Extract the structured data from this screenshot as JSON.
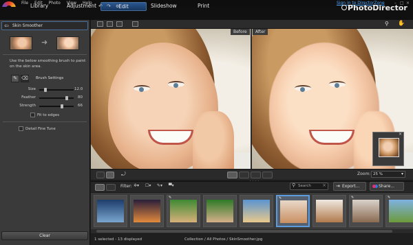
{
  "menu": {
    "items": [
      "File",
      "Edit",
      "Photo",
      "View",
      "Help"
    ]
  },
  "account": {
    "signin": "Sign in to DirectorZone"
  },
  "nav": {
    "tabs": [
      "Library",
      "Adjustment",
      "Edit",
      "Slideshow",
      "Print"
    ],
    "active": "Edit"
  },
  "brand": "PhotoDirector",
  "panel": {
    "title": "Skin Smoother",
    "description": "Use the below smoothing brush to paint on the skin area.",
    "brush_settings": "Brush Settings",
    "sliders": [
      {
        "label": "Size",
        "value": "12.0",
        "fraction": 0.12
      },
      {
        "label": "Feather",
        "value": "80",
        "fraction": 0.8
      },
      {
        "label": "Strength",
        "value": "66",
        "fraction": 0.66
      }
    ],
    "fit_to_edges": "Fit to edges",
    "detail_fine_tune": "Detail Fine Tune",
    "clear": "Clear"
  },
  "viewer": {
    "before": "Before",
    "after": "After"
  },
  "zoom": {
    "label": "Zoom:",
    "value": "25 %"
  },
  "filter": {
    "label": "Filter:",
    "search_placeholder": "Search",
    "export": "Export...",
    "share": "Share..."
  },
  "filmstrip": {
    "photos": [
      {
        "name": "dusk-sky",
        "edited": false,
        "colors": [
          "#1d3c6b",
          "#7aa6cf"
        ]
      },
      {
        "name": "sunset",
        "edited": false,
        "colors": [
          "#2a1e3a",
          "#e28a3c"
        ]
      },
      {
        "name": "puppy",
        "edited": true,
        "colors": [
          "#3f8a34",
          "#d8b17a"
        ]
      },
      {
        "name": "dog-grass",
        "edited": false,
        "colors": [
          "#2f7a28",
          "#d5b08a"
        ]
      },
      {
        "name": "beach",
        "edited": false,
        "colors": [
          "#5a94d0",
          "#e8c98c"
        ]
      },
      {
        "name": "smiling-woman",
        "edited": true,
        "colors": [
          "#e8d8c8",
          "#c98f62"
        ],
        "selected": true
      },
      {
        "name": "portrait-woman",
        "edited": false,
        "colors": [
          "#efe8e0",
          "#b07a4c"
        ]
      },
      {
        "name": "woman-laptop",
        "edited": true,
        "colors": [
          "#d9d2ca",
          "#8a6a50"
        ]
      },
      {
        "name": "landscape",
        "edited": true,
        "colors": [
          "#7fb2e2",
          "#6c9a3a"
        ]
      }
    ]
  },
  "status": {
    "count": "1 selected - 13 displayed",
    "path": "Collection / All Photos / SkinSmoother.jpg"
  },
  "colors": {
    "accent": "#4a6e9a",
    "selection": "#5b9bde",
    "link": "#4fa6ff"
  }
}
